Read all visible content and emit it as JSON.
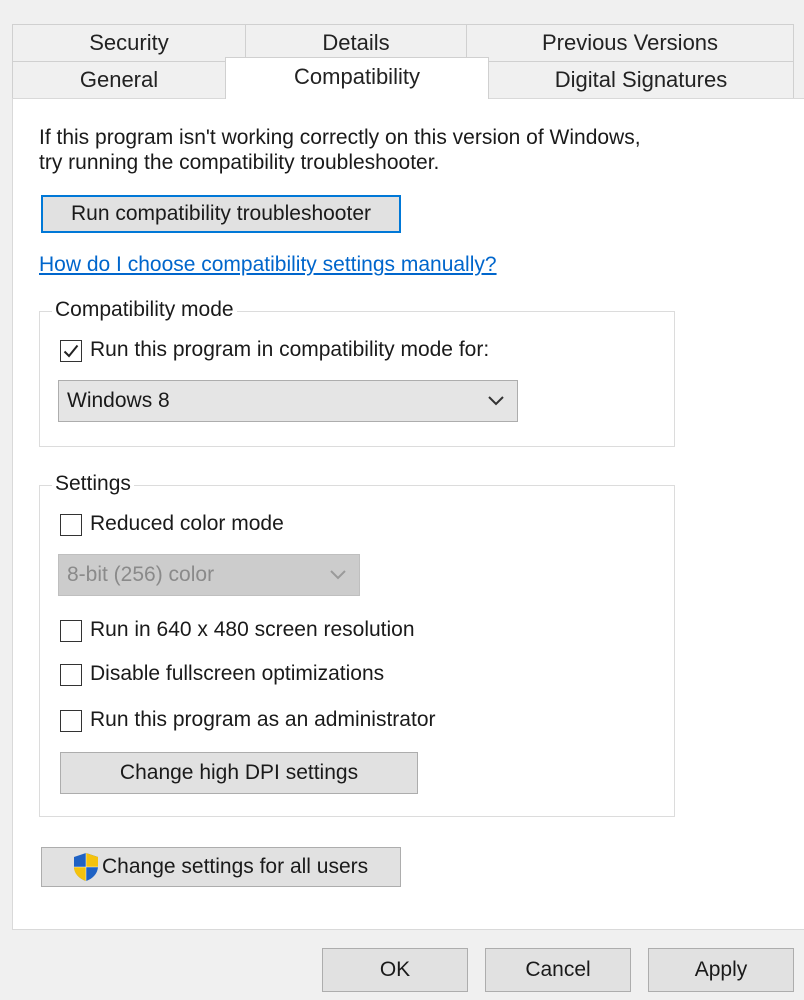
{
  "tabs": {
    "row1": [
      "Security",
      "Details",
      "Previous Versions"
    ],
    "row2": [
      "General",
      "Compatibility",
      "Digital Signatures"
    ],
    "active": "Compatibility"
  },
  "intro": {
    "line1": "If this program isn't working correctly on this version of Windows,",
    "line2": "try running the compatibility troubleshooter."
  },
  "troubleshooter_button": "Run compatibility troubleshooter",
  "manual_link": "How do I choose compatibility settings manually?",
  "compat_mode": {
    "legend": "Compatibility mode",
    "checkbox_label": "Run this program in compatibility mode for:",
    "checked": true,
    "selected": "Windows 8"
  },
  "settings": {
    "legend": "Settings",
    "reduced_color": {
      "label": "Reduced color mode",
      "checked": false
    },
    "color_select": {
      "selected": "8-bit (256) color",
      "disabled": true
    },
    "res_640": {
      "label": "Run in 640 x 480 screen resolution",
      "checked": false
    },
    "fullscreen": {
      "label": "Disable fullscreen optimizations",
      "checked": false
    },
    "admin": {
      "label": "Run this program as an administrator",
      "checked": false
    },
    "dpi_button": "Change high DPI settings"
  },
  "all_users_button": "Change settings for all users",
  "footer": {
    "ok": "OK",
    "cancel": "Cancel",
    "apply": "Apply"
  },
  "colors": {
    "accent": "#0078d7",
    "link": "#0066cc",
    "panel": "#ffffff",
    "window": "#f0f0f0"
  },
  "icons": {
    "uac": "uac-shield-icon",
    "dropdown": "chevron-down-icon",
    "check": "checkmark-icon"
  }
}
